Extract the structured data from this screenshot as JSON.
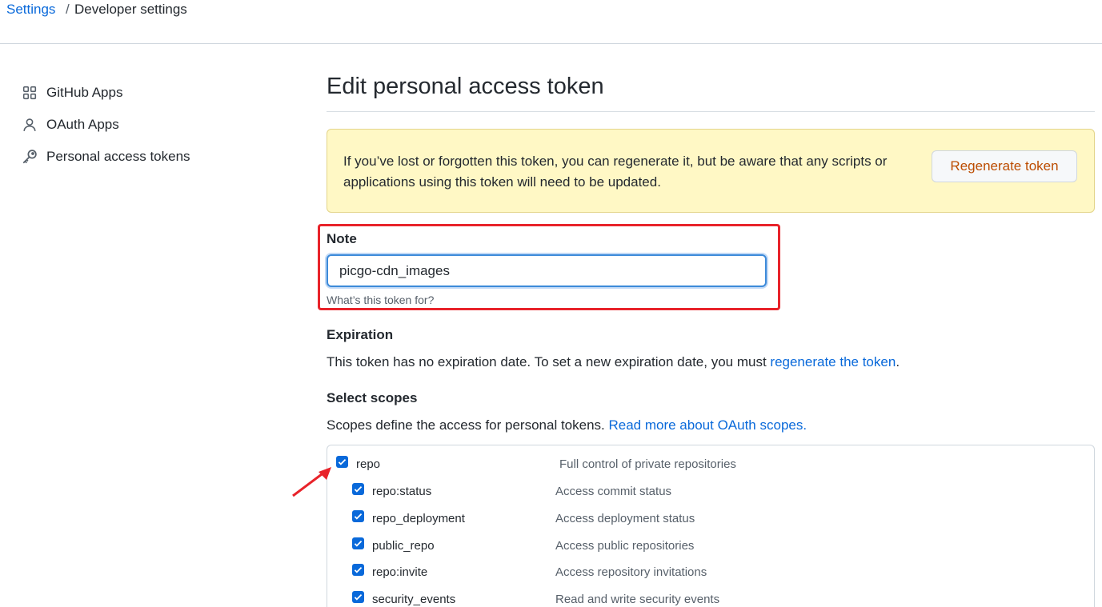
{
  "breadcrumb": {
    "root": "Settings",
    "separator": "/",
    "current": "Developer settings"
  },
  "sidebar": {
    "items": [
      {
        "label": "GitHub Apps",
        "icon": "apps-grid-icon"
      },
      {
        "label": "OAuth Apps",
        "icon": "person-icon"
      },
      {
        "label": "Personal access tokens",
        "icon": "key-icon"
      }
    ]
  },
  "main": {
    "title": "Edit personal access token",
    "flash": {
      "text": "If you’ve lost or forgotten this token, you can regenerate it, but be aware that any scripts or applications using this token will need to be updated.",
      "button": "Regenerate token"
    },
    "note": {
      "label": "Note",
      "value": "picgo-cdn_images",
      "hint": "What’s this token for?"
    },
    "expiration": {
      "label": "Expiration",
      "text": "This token has no expiration date. To set a new expiration date, you must ",
      "link": "regenerate the token",
      "suffix": "."
    },
    "scopes": {
      "label": "Select scopes",
      "text": "Scopes define the access for personal tokens. ",
      "link": "Read more about OAuth scopes.",
      "items": [
        {
          "name": "repo",
          "desc": "Full control of private repositories",
          "checked": true
        },
        {
          "name": "repo:status",
          "desc": "Access commit status",
          "checked": true
        },
        {
          "name": "repo_deployment",
          "desc": "Access deployment status",
          "checked": true
        },
        {
          "name": "public_repo",
          "desc": "Access public repositories",
          "checked": true
        },
        {
          "name": "repo:invite",
          "desc": "Access repository invitations",
          "checked": true
        },
        {
          "name": "security_events",
          "desc": "Read and write security events",
          "checked": true
        }
      ]
    }
  },
  "colors": {
    "link": "#0969da",
    "highlight": "#e8232a",
    "flash_bg": "#fff8c5",
    "checkbox": "#0969da"
  }
}
